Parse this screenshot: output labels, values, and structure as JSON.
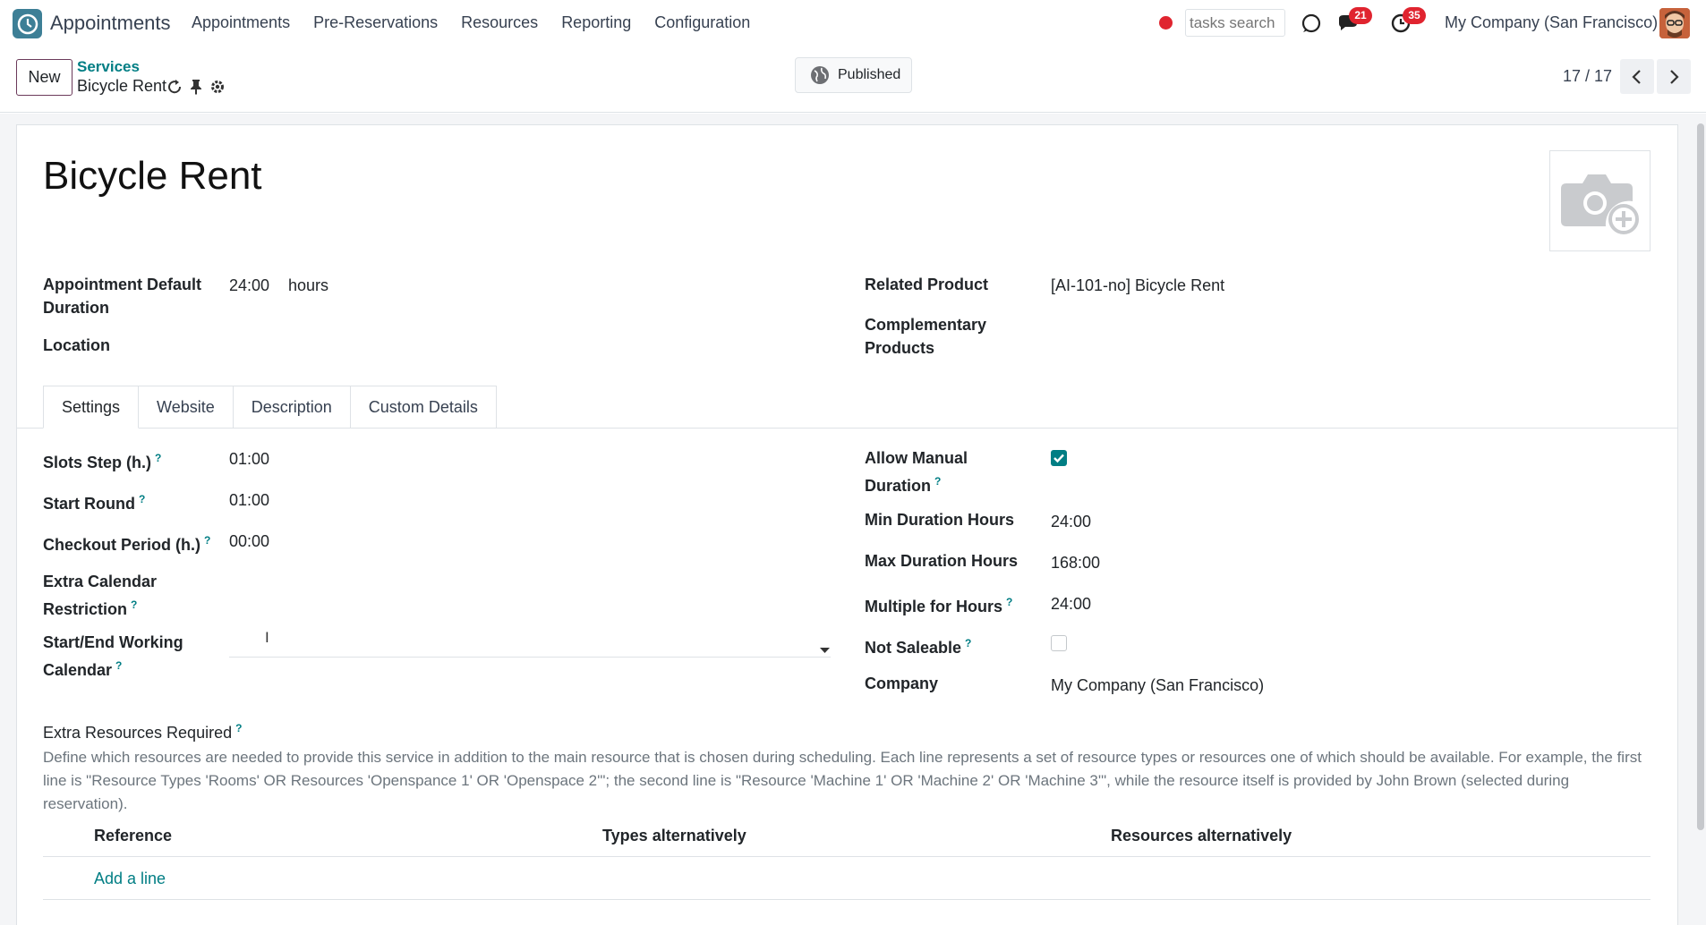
{
  "navbar": {
    "app_name": "Appointments",
    "menu": [
      "Appointments",
      "Pre-Reservations",
      "Resources",
      "Reporting",
      "Configuration"
    ],
    "search_placeholder": "tasks search",
    "messages_count": "21",
    "activities_count": "35",
    "company": "My Company (San Francisco)"
  },
  "control": {
    "new_label": "New",
    "breadcrumb_parent": "Services",
    "breadcrumb_current": "Bicycle Rent",
    "published_label": "Published",
    "pager": "17 / 17"
  },
  "record": {
    "title": "Bicycle Rent",
    "left_fields": {
      "duration_label": "Appointment Default Duration",
      "duration_value": "24:00",
      "duration_unit": "hours",
      "location_label": "Location",
      "location_value": ""
    },
    "right_fields": {
      "related_product_label": "Related Product",
      "related_product_value": "[AI-101-no] Bicycle Rent",
      "complementary_label": "Complementary Products",
      "complementary_value": ""
    }
  },
  "tabs": [
    "Settings",
    "Website",
    "Description",
    "Custom Details"
  ],
  "active_tab": "Settings",
  "settings": {
    "left": [
      {
        "label": "Slots Step (h.)",
        "value": "01:00",
        "help": "?"
      },
      {
        "label": "Start Round",
        "value": "01:00",
        "help": "?"
      },
      {
        "label": "Checkout Period (h.)",
        "value": "00:00",
        "help": "?"
      },
      {
        "label": "Extra Calendar Restriction",
        "value": "",
        "help": "?"
      },
      {
        "label": "Start/End Working Calendar",
        "value": "",
        "help": "?"
      }
    ],
    "right": {
      "allow_manual_label": "Allow Manual Duration",
      "allow_manual_checked": true,
      "min_duration_label": "Min Duration Hours",
      "min_duration_value": "24:00",
      "max_duration_label": "Max Duration Hours",
      "max_duration_value": "168:00",
      "multiple_label": "Multiple for Hours",
      "multiple_value": "24:00",
      "not_saleable_label": "Not Saleable",
      "not_saleable_checked": false,
      "company_label": "Company",
      "company_value": "My Company (San Francisco)"
    }
  },
  "extra_resources": {
    "title": "Extra Resources Required",
    "description": "Define which resources are needed to provide this service in addition to the main resource that is chosen during scheduling. Each line represents a set of resource types or resources one of which should be available. For example, the first line is \"Resource Types 'Rooms' OR Resources 'Openspance 1' OR 'Openspace 2'\"; the second line is \"Resource 'Machine 1' OR 'Machine 2' OR 'Machine 3'\", while the resource itself is provided by John Brown (selected during reservation).",
    "columns": [
      "Reference",
      "Types alternatively",
      "Resources alternatively"
    ],
    "add_line": "Add a line"
  },
  "colors": {
    "accent": "#017e84",
    "badge": "#e0242f",
    "new_button_border": "#6b3a5a"
  }
}
